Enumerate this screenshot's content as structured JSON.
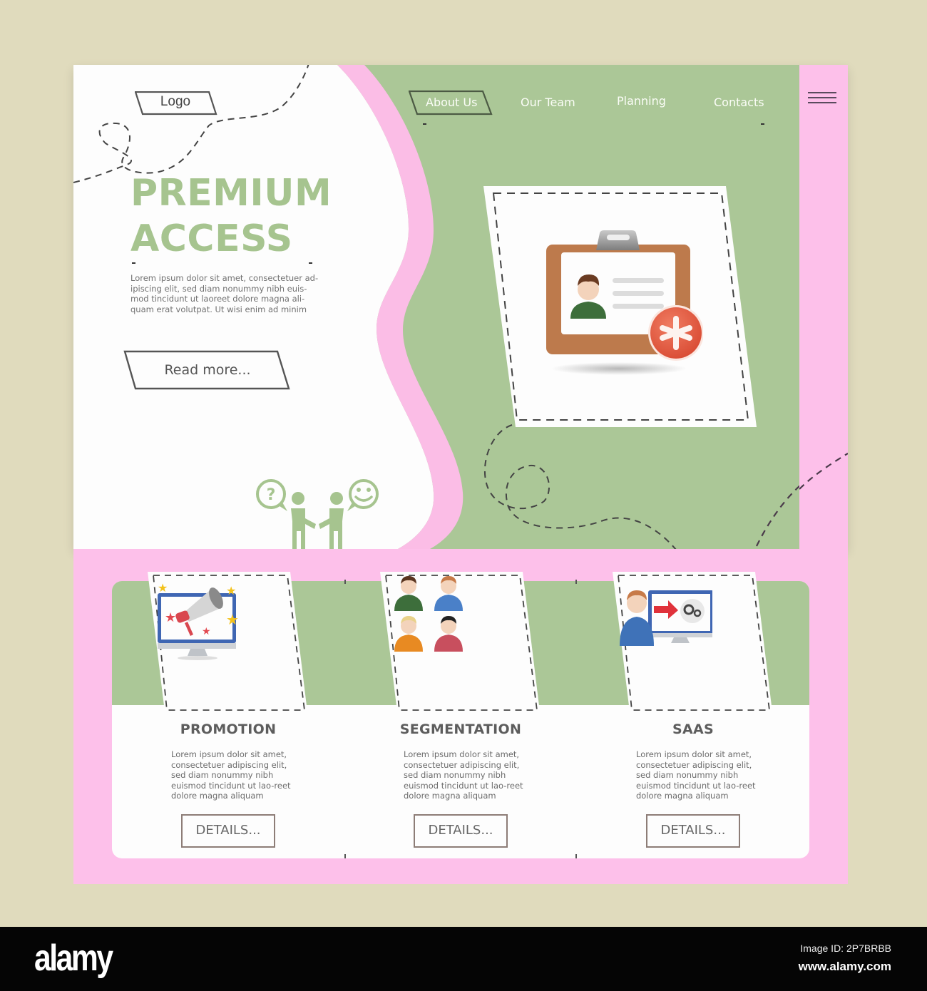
{
  "header": {
    "logo_label": "Logo",
    "nav": [
      {
        "label": "About Us",
        "active": true
      },
      {
        "label": "Our Team",
        "active": false
      },
      {
        "label": "Planning",
        "active": false
      },
      {
        "label": "Contacts",
        "active": false
      }
    ],
    "menu_icon": "hamburger-menu-icon"
  },
  "hero": {
    "title_line1": "PREMIUM",
    "title_line2": "ACCESS",
    "body": "Lorem ipsum dolor sit amet, consectetuer ad-ipiscing elit, sed diam nonummy nibh euis-mod tincidunt ut laoreet dolore magna ali-quam erat volutpat. Ut wisi enim ad minim",
    "cta_label": "Read more...",
    "illustration": "id-badge-with-asterisk-icon",
    "decoration": "handshake-dialogue-icon"
  },
  "features": [
    {
      "title": "PROMOTION",
      "icon": "megaphone-monitor-icon",
      "body": "Lorem ipsum dolor sit amet, consectetuer adipiscing elit, sed diam nonummy nibh euismod tincidunt ut lao-reet dolore magna aliquam",
      "button_label": "DETAILS..."
    },
    {
      "title": "SEGMENTATION",
      "icon": "user-group-icon",
      "body": "Lorem ipsum dolor sit amet, consectetuer adipiscing elit, sed diam nonummy nibh euismod tincidunt ut lao-reet dolore magna aliquam",
      "button_label": "DETAILS..."
    },
    {
      "title": "SAAS",
      "icon": "user-cloud-settings-icon",
      "body": "Lorem ipsum dolor sit amet, consectetuer adipiscing elit, sed diam nonummy nibh euismod tincidunt ut lao-reet dolore magna aliquam",
      "button_label": "DETAILS..."
    }
  ],
  "colors": {
    "background": "#e0dbbd",
    "green": "#abc797",
    "pink": "#fdc0ea",
    "title_green": "#a6c48f",
    "text_gray": "#6b6b6b",
    "button_border": "#8d7d77"
  },
  "watermark": {
    "brand": "alamy",
    "image_id": "Image ID: 2P7BRBB",
    "url": "www.alamy.com"
  }
}
